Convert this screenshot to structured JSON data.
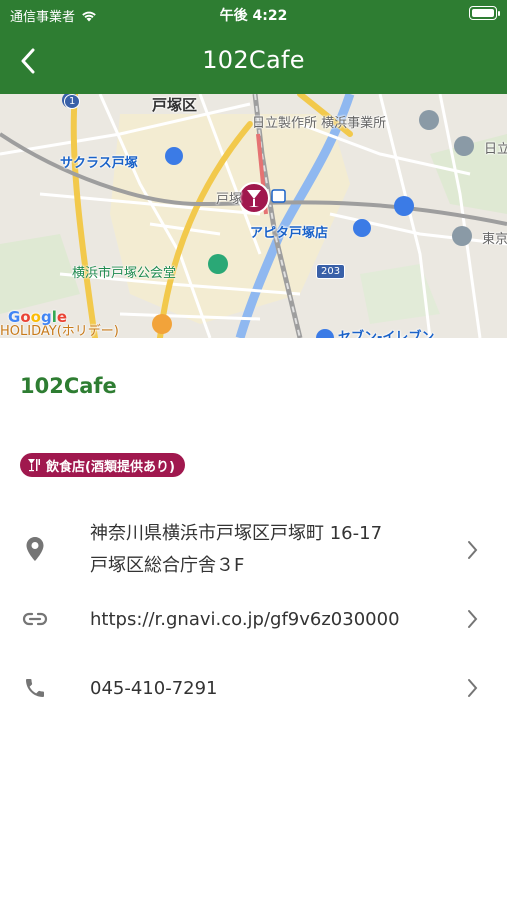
{
  "status_bar": {
    "carrier": "通信事業者",
    "time": "午後 4:22"
  },
  "app_bar": {
    "title": "102Cafe",
    "back_icon": "chevron-left-icon"
  },
  "map": {
    "labels": {
      "totsuka_ward": "戸塚区",
      "hitachi": "日立製作所 横浜事業所",
      "hitachi_short": "日立",
      "sakurasu": "サクラス戸塚",
      "totsuka_station": "戸塚",
      "apita": "アピタ戸塚店",
      "tokyo_partial": "東京",
      "public_hall": "横浜市戸塚公会堂",
      "holiday": "HOLIDAY(ホリデー)",
      "seven": "セブン-イレブン",
      "route": "203",
      "route_1": "1"
    },
    "google_logo": "Google"
  },
  "place": {
    "name": "102Cafe",
    "category": "飲食店(酒類提供あり)",
    "category_icon": "wine-glass-icon",
    "category_color": "#a0184e"
  },
  "details": {
    "address_line1": "神奈川県横浜市戸塚区戸塚町 16-17",
    "address_line2": "戸塚区総合庁舎３F",
    "url": "https://r.gnavi.co.jp/gf9v6z030000",
    "phone": "045-410-7291"
  },
  "colors": {
    "primary": "#2e7d32",
    "accent_pin": "#a0184e",
    "text": "#333333",
    "icon": "#757575"
  }
}
